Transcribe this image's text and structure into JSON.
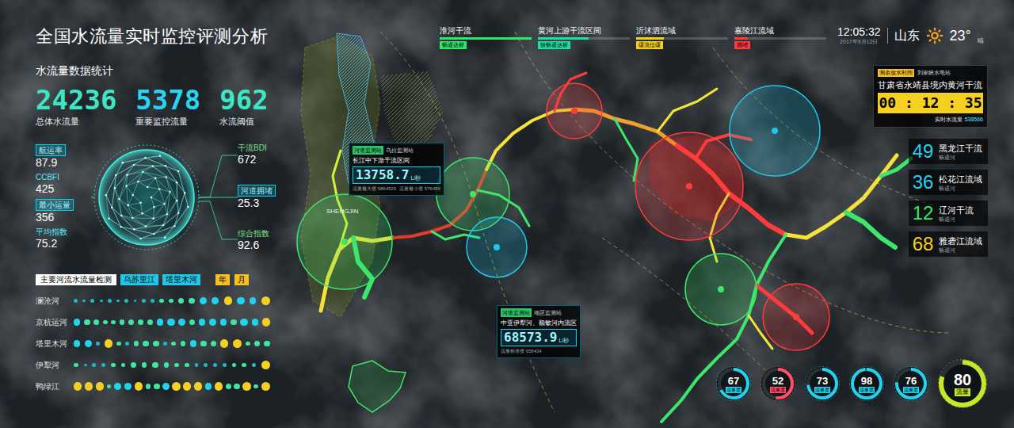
{
  "title": "全国水流量实时监控评测分析",
  "header_tabs": [
    {
      "name": "淮河干流",
      "badge": "畅通达标",
      "level": 1,
      "color": "#2ee86b"
    },
    {
      "name": "黄河上游干流区间",
      "badge": "较畅通达标",
      "level": 0.55,
      "color": "#1fe0a0"
    },
    {
      "name": "沂沭泗流域",
      "badge": "缓流位缓",
      "level": 0.3,
      "color": "#f5d020"
    },
    {
      "name": "嘉陵江流域",
      "badge": "拥堵",
      "level": 0.15,
      "color": "#ff3b3b"
    }
  ],
  "clock": {
    "time": "12:05:32",
    "date": "2017年9月12日",
    "region": "山东",
    "temperature": "23°",
    "weather": "晴"
  },
  "stats": {
    "heading": "水流量数据统计",
    "items": [
      {
        "value": "24236",
        "label": "总体水流量",
        "color": "#3ee6c4"
      },
      {
        "value": "5378",
        "label": "重要监控流量",
        "color": "#2ad4f0"
      },
      {
        "value": "962",
        "label": "水流阈值",
        "color": "#3ee6c4"
      }
    ]
  },
  "globe_metrics": {
    "left": [
      {
        "label": "航运率",
        "value": "87.9",
        "highlighted": true
      },
      {
        "label": "CCBFI",
        "value": "425",
        "highlighted": false
      },
      {
        "label": "最小运量",
        "value": "356",
        "highlighted": true
      },
      {
        "label": "平均指数",
        "value": "75.2",
        "highlighted": false
      }
    ],
    "right": [
      {
        "label": "干流BDI",
        "value": "672",
        "highlighted": false
      },
      {
        "label": "河道拥堵",
        "value": "25.3",
        "highlighted": true
      },
      {
        "label": "综合指数",
        "value": "92.6",
        "highlighted": false
      }
    ]
  },
  "river_chart": {
    "title": "主要河流水流量检测",
    "tabs": [
      {
        "label": "乌苏里江"
      },
      {
        "label": "塔里木河"
      }
    ],
    "periods": [
      {
        "label": "年"
      },
      {
        "label": "月"
      }
    ],
    "rows": [
      {
        "name": "澜沧河",
        "values": [
          2,
          1,
          2,
          1,
          2,
          1,
          2,
          1,
          2,
          2,
          3,
          3,
          4,
          5,
          6,
          7,
          8,
          7,
          6,
          9
        ]
      },
      {
        "name": "京杭运河",
        "values": [
          6,
          5,
          4,
          3,
          3,
          4,
          4,
          5,
          5,
          6,
          7,
          6,
          5,
          6,
          7,
          6,
          5,
          7,
          6,
          8
        ]
      },
      {
        "name": "塔里木河",
        "values": [
          6,
          7,
          2,
          8,
          3,
          2,
          4,
          5,
          5,
          2,
          3,
          4,
          6,
          5,
          4,
          8,
          9,
          3,
          4,
          5
        ]
      },
      {
        "name": "伊犁河",
        "values": [
          3,
          1,
          2,
          2,
          3,
          3,
          4,
          4,
          5,
          4,
          3,
          3,
          2,
          2,
          2,
          2,
          3,
          3,
          2,
          9
        ]
      },
      {
        "name": "鸭绿江",
        "values": [
          8,
          8,
          8,
          3,
          7,
          7,
          8,
          4,
          5,
          6,
          8,
          8,
          8,
          6,
          8,
          4,
          5,
          8,
          3,
          9
        ]
      }
    ]
  },
  "map_labels": [
    "SHENGJIN"
  ],
  "map_markers": [
    {
      "color": "#3ee66b"
    },
    {
      "color": "#3ee66b"
    },
    {
      "color": "#22c7e8"
    },
    {
      "color": "#ff3b3b"
    },
    {
      "color": "#ff3b3b"
    },
    {
      "color": "#22c7e8"
    },
    {
      "color": "#3ee66b"
    },
    {
      "color": "#ff3b3b"
    }
  ],
  "callouts": [
    {
      "badge": "河道监测站",
      "tag": "乌拉监测站",
      "name": "长江中下游干流区间",
      "value": "13758.7",
      "unit": "L/秒",
      "footer": [
        "流量最大值 5864525",
        "流量最小值 576489"
      ]
    },
    {
      "badge": "河道监测站",
      "tag": "地区监测站",
      "name": "中亚伊犁河、额敏河内流区",
      "value": "68573.9",
      "unit": "L/秒",
      "footer": [
        "流量标准值 658434"
      ]
    }
  ],
  "countdown": {
    "badge": "测余放水时间",
    "station": "刘家峡水电站",
    "location": "甘肃省永靖县境内黄河干流",
    "timer": "00 : 12 : 35",
    "reading_label": "实时水流量",
    "reading": "538566"
  },
  "basins": [
    {
      "value": "49",
      "name": "黑龙江干流",
      "status": "畅通河",
      "color": "#22d3ee"
    },
    {
      "value": "36",
      "name": "松花江流域",
      "status": "畅通河",
      "color": "#22d3ee"
    },
    {
      "value": "12",
      "name": "辽河干流",
      "status": "畅通河",
      "color": "#3ee66b"
    },
    {
      "value": "68",
      "name": "雅砻江流域",
      "status": "畅通河",
      "color": "#f5d020"
    }
  ],
  "gauges": [
    {
      "value": "67",
      "label": "流量度",
      "level": 0.67,
      "color": "#22d3ee",
      "kind": "small"
    },
    {
      "value": "52",
      "label": "流量度",
      "level": 0.52,
      "color": "#ff4d6a",
      "kind": "small"
    },
    {
      "value": "73",
      "label": "流量度",
      "level": 0.73,
      "color": "#22d3ee",
      "kind": "small"
    },
    {
      "value": "98",
      "label": "流量度",
      "level": 0.98,
      "color": "#22d3ee",
      "kind": "small"
    },
    {
      "value": "76",
      "label": "流量度",
      "level": 0.76,
      "color": "#22d3ee",
      "kind": "small"
    },
    {
      "value": "80",
      "label": "流量",
      "level": 0.8,
      "color": "#c8e62a",
      "kind": "large"
    }
  ]
}
